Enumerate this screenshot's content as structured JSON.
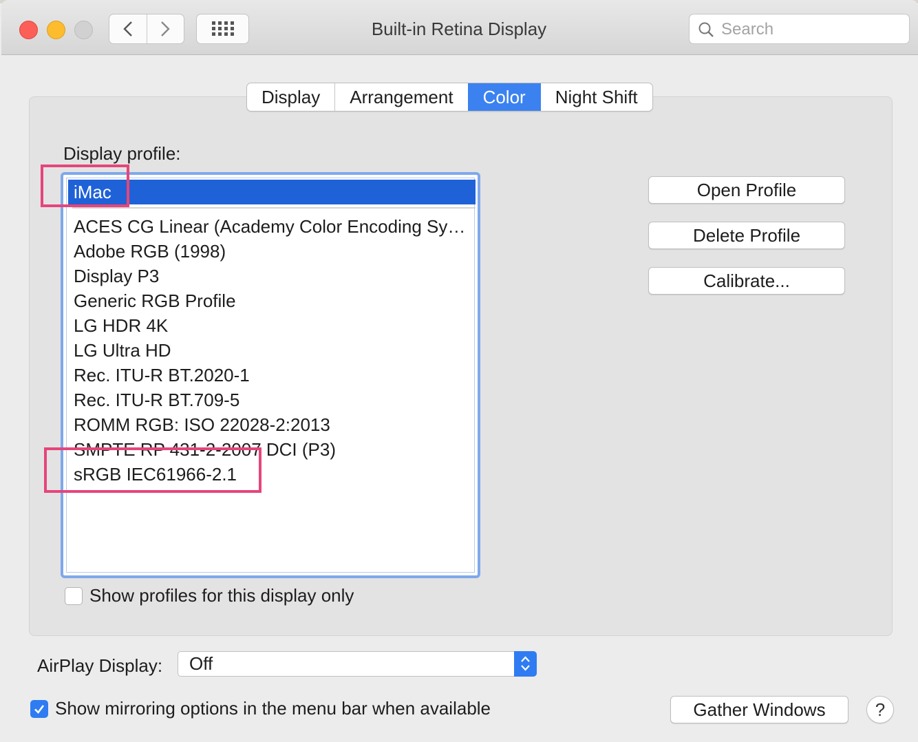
{
  "window": {
    "title": "Built-in Retina Display"
  },
  "toolbar": {
    "back_icon": "chevron-left-icon",
    "forward_icon": "chevron-right-icon",
    "grid_icon": "show-all-grid-icon"
  },
  "search": {
    "placeholder": "Search",
    "icon": "magnifier-icon"
  },
  "tabs": [
    {
      "label": "Display",
      "active": false
    },
    {
      "label": "Arrangement",
      "active": false
    },
    {
      "label": "Color",
      "active": true
    },
    {
      "label": "Night Shift",
      "active": false
    }
  ],
  "profile": {
    "label": "Display profile:",
    "selected": "iMac",
    "items": [
      "ACES CG Linear (Academy Color Encoding Sy…",
      "Adobe RGB (1998)",
      "Display P3",
      "Generic RGB Profile",
      "LG HDR 4K",
      "LG Ultra HD",
      "Rec. ITU-R BT.2020-1",
      "Rec. ITU-R BT.709-5",
      "ROMM RGB: ISO 22028-2:2013",
      "SMPTE RP 431-2-2007 DCI (P3)",
      "sRGB IEC61966-2.1"
    ]
  },
  "buttons": {
    "open_profile": "Open Profile",
    "delete_profile": "Delete Profile",
    "calibrate": "Calibrate..."
  },
  "show_profiles_only": {
    "label": "Show profiles for this display only",
    "checked": false
  },
  "airplay": {
    "label": "AirPlay Display:",
    "value": "Off"
  },
  "mirroring": {
    "label": "Show mirroring options in the menu bar when available",
    "checked": true
  },
  "gather_windows": "Gather Windows",
  "help": "?",
  "colors": {
    "accent": "#3b82f0",
    "selection": "#1f62d7",
    "annotation": "#e5457a"
  }
}
